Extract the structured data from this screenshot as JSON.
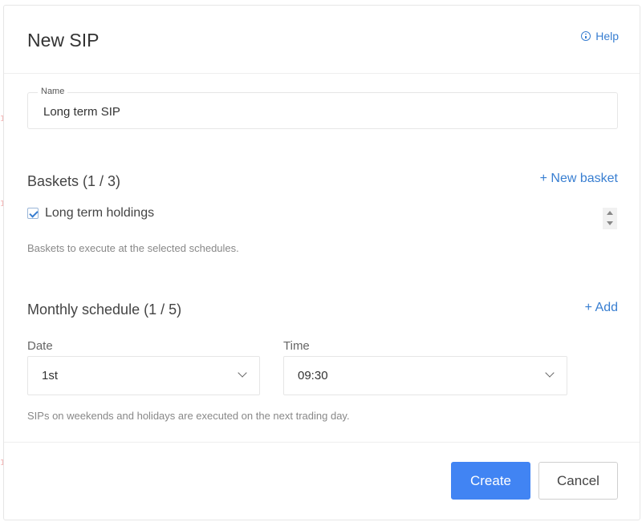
{
  "header": {
    "title": "New SIP",
    "help_label": "Help"
  },
  "name_field": {
    "label": "Name",
    "value": "Long term SIP"
  },
  "baskets": {
    "title": "Baskets (1 / 3)",
    "action_label": "+ New basket",
    "items": [
      {
        "label": "Long term holdings",
        "checked": true
      }
    ],
    "hint": "Baskets to execute at the selected schedules."
  },
  "schedule": {
    "title": "Monthly schedule (1 / 5)",
    "action_label": "+ Add",
    "date_label": "Date",
    "date_value": "1st",
    "time_label": "Time",
    "time_value": "09:30",
    "hint": "SIPs on weekends and holidays are executed on the next trading day."
  },
  "footer": {
    "create_label": "Create",
    "cancel_label": "Cancel"
  },
  "colors": {
    "accent": "#387ed1",
    "primary_button": "#4184f3"
  }
}
